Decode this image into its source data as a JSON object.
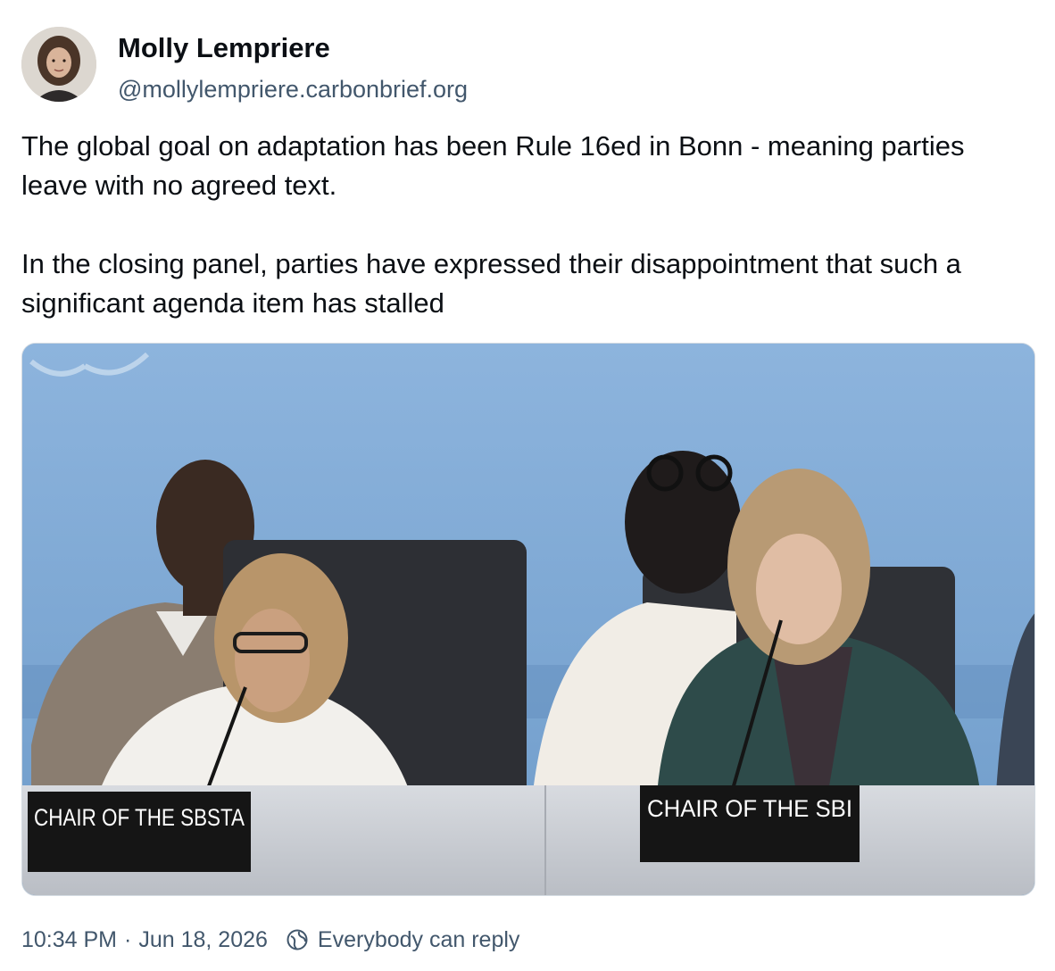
{
  "author": {
    "display_name": "Molly Lempriere",
    "handle": "@mollylempriere.carbonbrief.org",
    "avatar_icon": "profile-photo"
  },
  "post": {
    "paragraphs": [
      "The global goal on adaptation has been Rule 16ed in Bonn - meaning parties leave with no agreed text.",
      "In the closing panel, parties have expressed their disappointment that such a significant agenda item has stalled"
    ]
  },
  "media": {
    "placards": {
      "left": "CHAIR OF THE SBSTA",
      "right": "CHAIR OF THE SBI"
    }
  },
  "meta": {
    "time": "10:34 PM",
    "separator": "·",
    "date": "Jun 18, 2026",
    "reply_setting": "Everybody can reply",
    "reply_icon": "globe-icon"
  },
  "colors": {
    "text_primary": "#0b0f14",
    "text_secondary": "#42576c",
    "backdrop_blue": "#7fa8d6"
  }
}
